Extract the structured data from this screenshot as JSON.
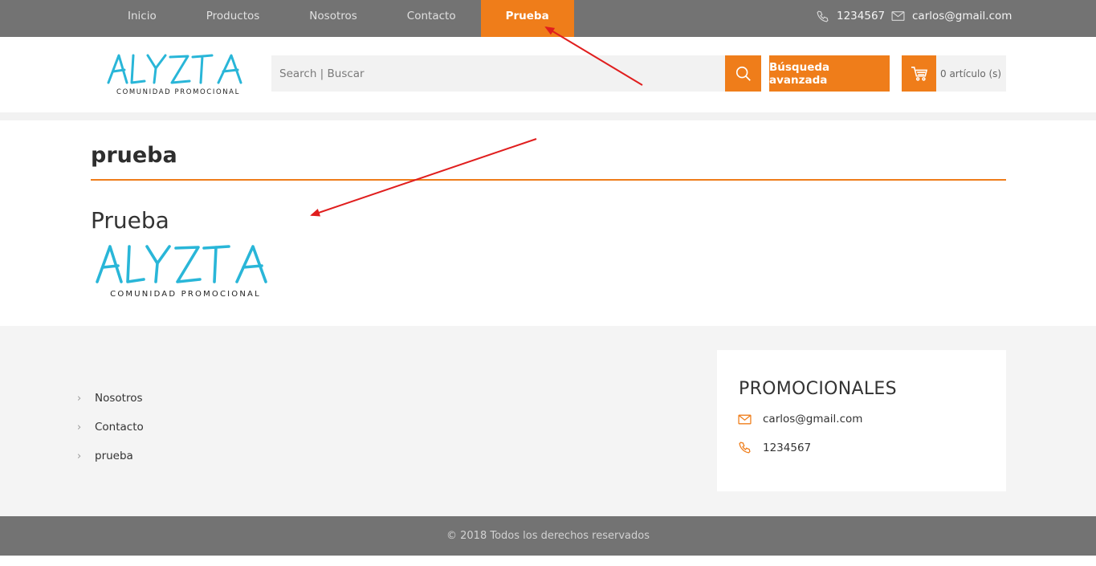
{
  "nav": {
    "items": [
      {
        "label": "Inicio",
        "active": false
      },
      {
        "label": "Productos",
        "active": false
      },
      {
        "label": "Nosotros",
        "active": false
      },
      {
        "label": "Contacto",
        "active": false
      },
      {
        "label": "Prueba",
        "active": true
      }
    ],
    "phone": "1234567",
    "email": "carlos@gmail.com"
  },
  "header": {
    "logo_text": "ALYZTA",
    "logo_tagline": "COMUNIDAD PROMOCIONAL",
    "search_placeholder": "Search | Buscar",
    "search_icon": "search-icon",
    "advanced_search_label": "Búsqueda avanzada",
    "cart_label": "0 artículo (s)",
    "cart_icon": "cart-icon"
  },
  "content": {
    "page_title": "prueba",
    "section_heading": "Prueba",
    "logo_text": "ALYZTA",
    "logo_tagline": "COMUNIDAD PROMOCIONAL"
  },
  "footer": {
    "links": [
      "Nosotros",
      "Contacto",
      "prueba"
    ],
    "promo_title": "PROMOCIONALES",
    "promo_email": "carlos@gmail.com",
    "promo_phone": "1234567",
    "copyright": "© 2018 Todos los derechos reservados"
  },
  "colors": {
    "accent": "#ef7d1a",
    "topbar": "#737373",
    "logo_blue": "#29b6d8",
    "annotation_arrow": "#e01e1e"
  }
}
